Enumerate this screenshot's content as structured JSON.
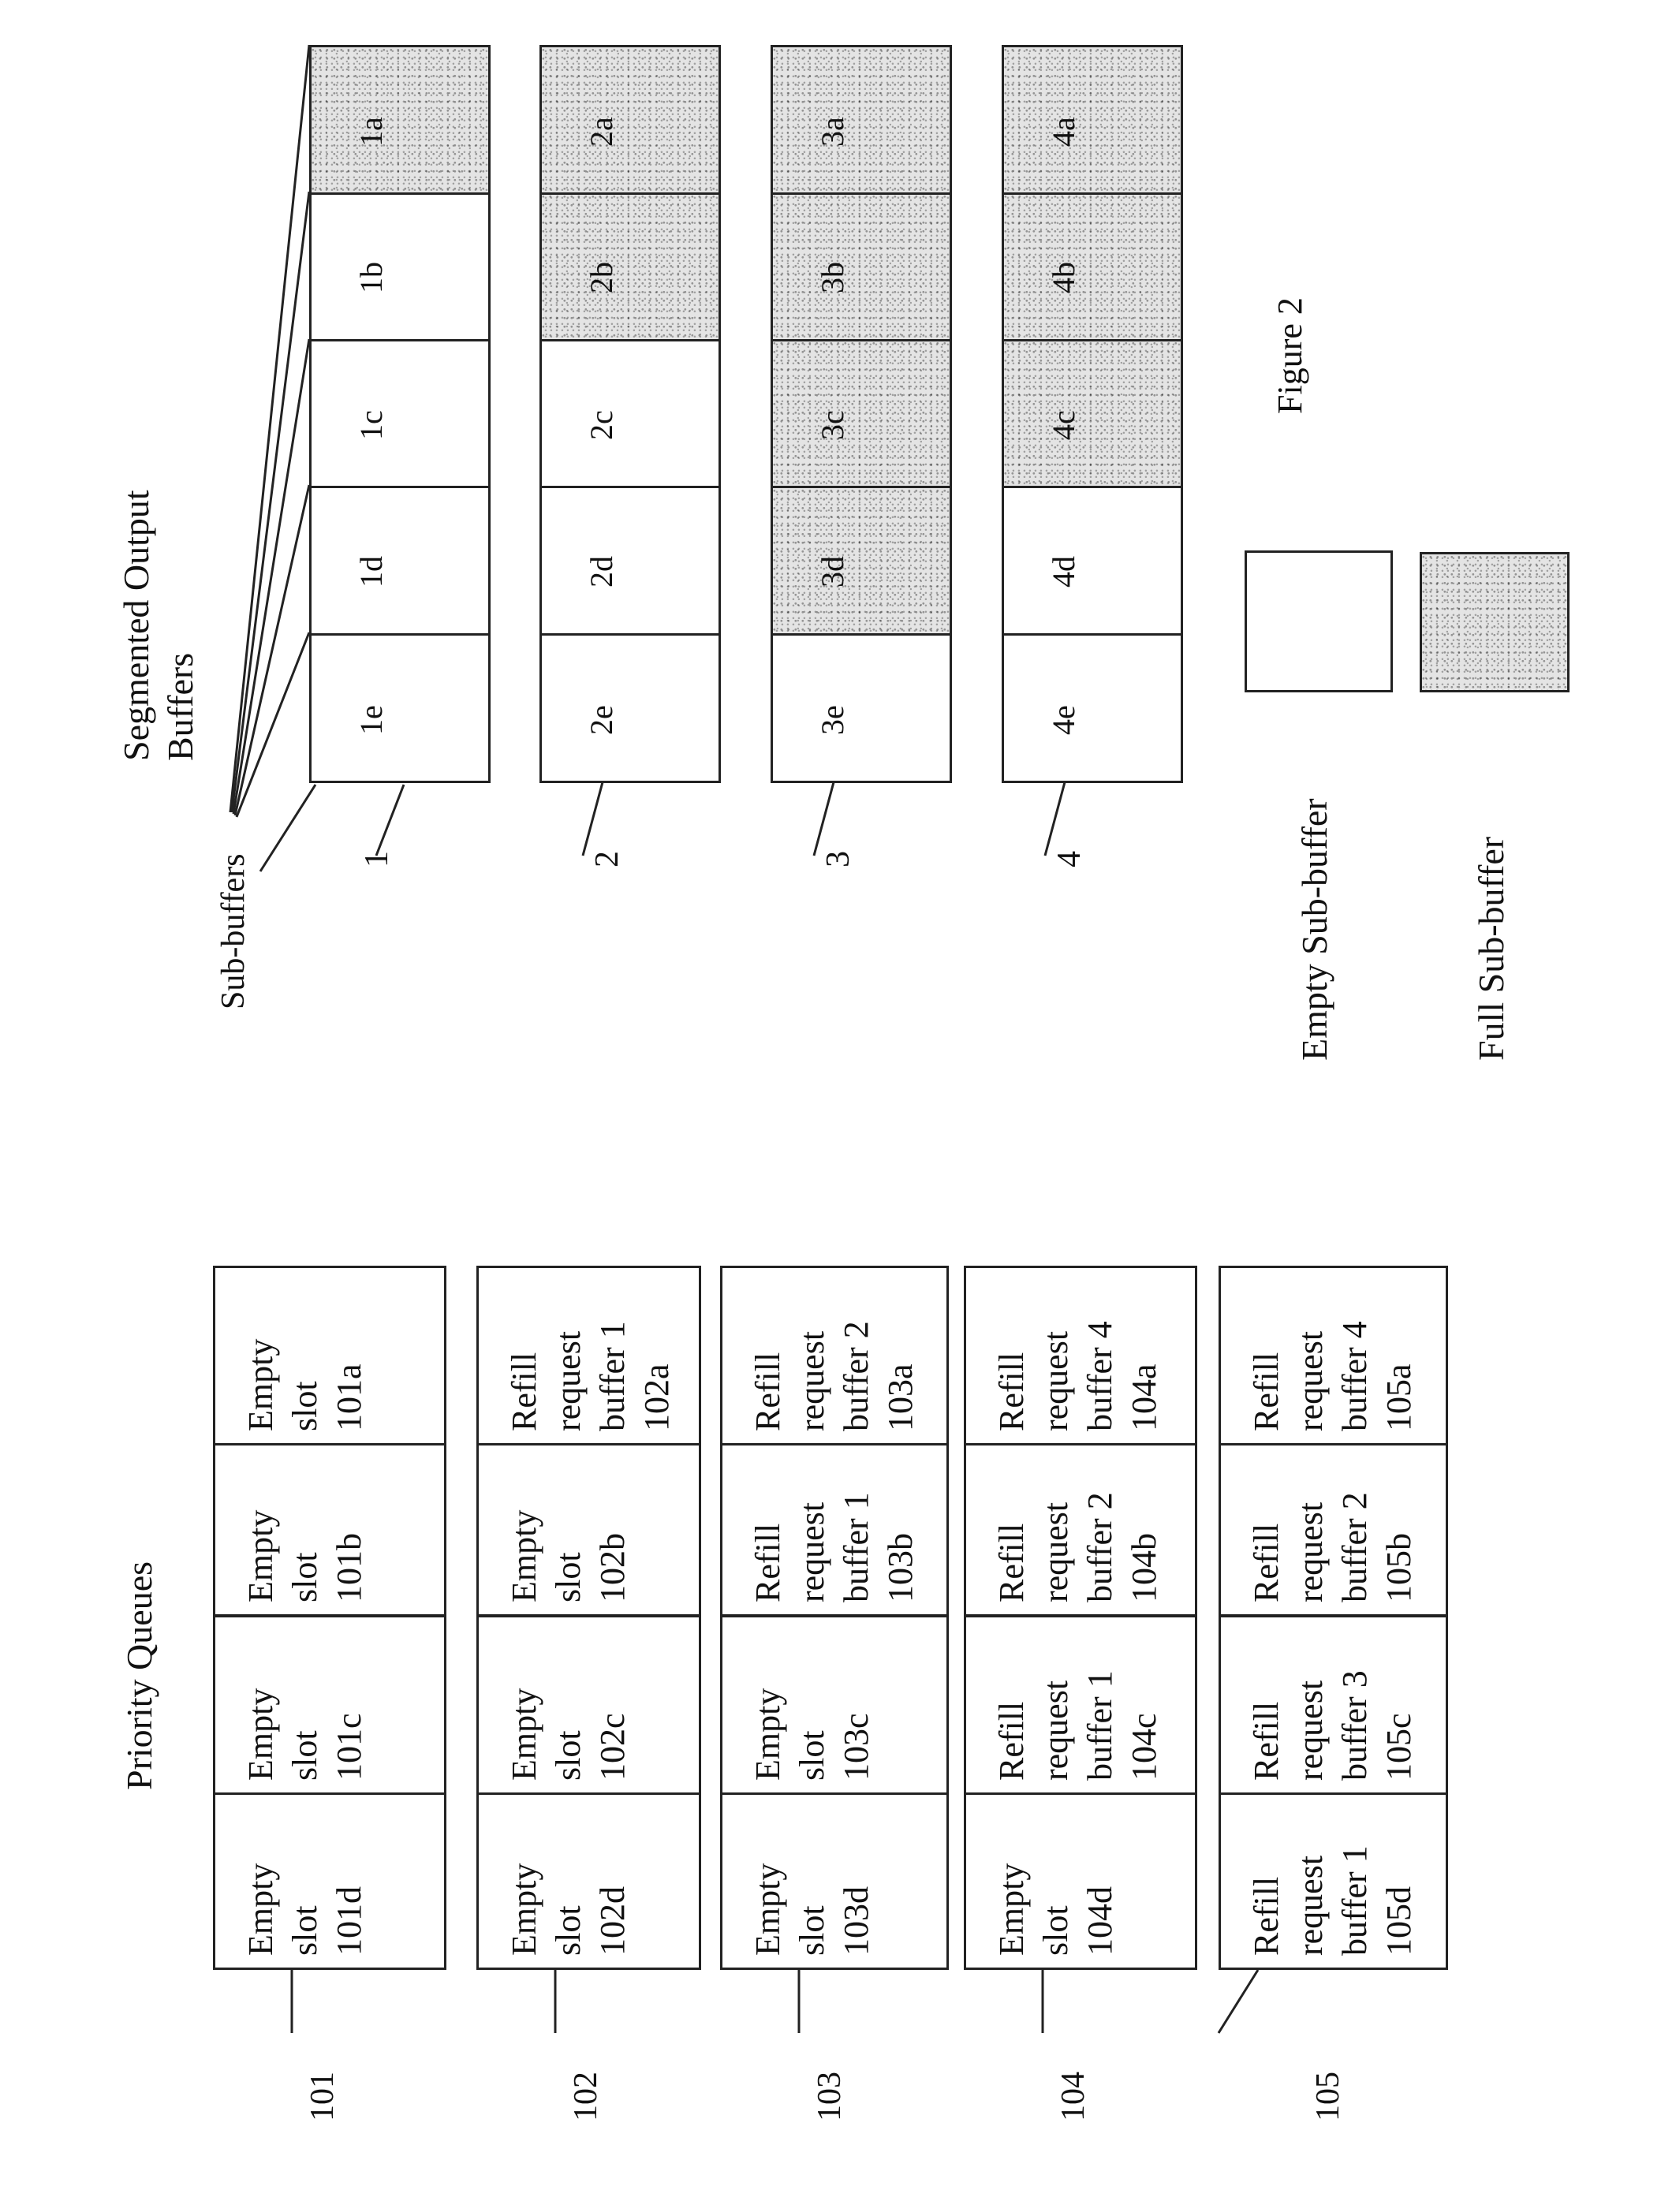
{
  "figure": {
    "caption": "Figure 2",
    "output_buffers_title_line1": "Segmented Output",
    "output_buffers_title_line2": "Buffers",
    "sub_buffers_label": "Sub-buffers",
    "priority_queues_title": "Priority Queues"
  },
  "legend": {
    "empty_label": "Empty Sub-buffer",
    "full_label": "Full Sub-buffer",
    "empty_color": "#ffffff",
    "full_color": "#e4e4e4"
  },
  "output_buffers": [
    {
      "ref": "1",
      "cells": [
        {
          "label": "1e",
          "state": "empty"
        },
        {
          "label": "1d",
          "state": "empty"
        },
        {
          "label": "1c",
          "state": "empty"
        },
        {
          "label": "1b",
          "state": "empty"
        },
        {
          "label": "1a",
          "state": "full"
        }
      ]
    },
    {
      "ref": "2",
      "cells": [
        {
          "label": "2e",
          "state": "empty"
        },
        {
          "label": "2d",
          "state": "empty"
        },
        {
          "label": "2c",
          "state": "empty"
        },
        {
          "label": "2b",
          "state": "full"
        },
        {
          "label": "2a",
          "state": "full"
        }
      ]
    },
    {
      "ref": "3",
      "cells": [
        {
          "label": "3e",
          "state": "empty"
        },
        {
          "label": "3d",
          "state": "full"
        },
        {
          "label": "3c",
          "state": "full"
        },
        {
          "label": "3b",
          "state": "full"
        },
        {
          "label": "3a",
          "state": "full"
        }
      ]
    },
    {
      "ref": "4",
      "cells": [
        {
          "label": "4e",
          "state": "empty"
        },
        {
          "label": "4d",
          "state": "empty"
        },
        {
          "label": "4c",
          "state": "full"
        },
        {
          "label": "4b",
          "state": "full"
        },
        {
          "label": "4a",
          "state": "full"
        }
      ]
    }
  ],
  "priority_queues": [
    {
      "ref": "101",
      "slots": [
        [
          "Empty",
          "slot",
          "101d"
        ],
        [
          "Empty",
          "slot",
          "101c"
        ],
        [
          "Empty",
          "slot",
          "101b"
        ],
        [
          "Empty",
          "slot",
          "101a"
        ]
      ]
    },
    {
      "ref": "102",
      "slots": [
        [
          "Empty",
          "slot",
          "102d"
        ],
        [
          "Empty",
          "slot",
          "102c"
        ],
        [
          "Empty",
          "slot",
          "102b"
        ],
        [
          "Refill",
          "request",
          "buffer 1",
          "102a"
        ]
      ]
    },
    {
      "ref": "103",
      "slots": [
        [
          "Empty",
          "slot",
          "103d"
        ],
        [
          "Empty",
          "slot",
          "103c"
        ],
        [
          "Refill",
          "request",
          "buffer 1",
          "103b"
        ],
        [
          "Refill",
          "request",
          "buffer 2",
          "103a"
        ]
      ]
    },
    {
      "ref": "104",
      "slots": [
        [
          "Empty",
          "slot",
          "104d"
        ],
        [
          "Refill",
          "request",
          "buffer 1",
          "104c"
        ],
        [
          "Refill",
          "request",
          "buffer 2",
          "104b"
        ],
        [
          "Refill",
          "request",
          "buffer 4",
          "104a"
        ]
      ]
    },
    {
      "ref": "105",
      "slots": [
        [
          "Refill",
          "request",
          "buffer 1",
          "105d"
        ],
        [
          "Refill",
          "request",
          "buffer 3",
          "105c"
        ],
        [
          "Refill",
          "request",
          "buffer 2",
          "105b"
        ],
        [
          "Refill",
          "request",
          "buffer 4",
          "105a"
        ]
      ]
    }
  ]
}
